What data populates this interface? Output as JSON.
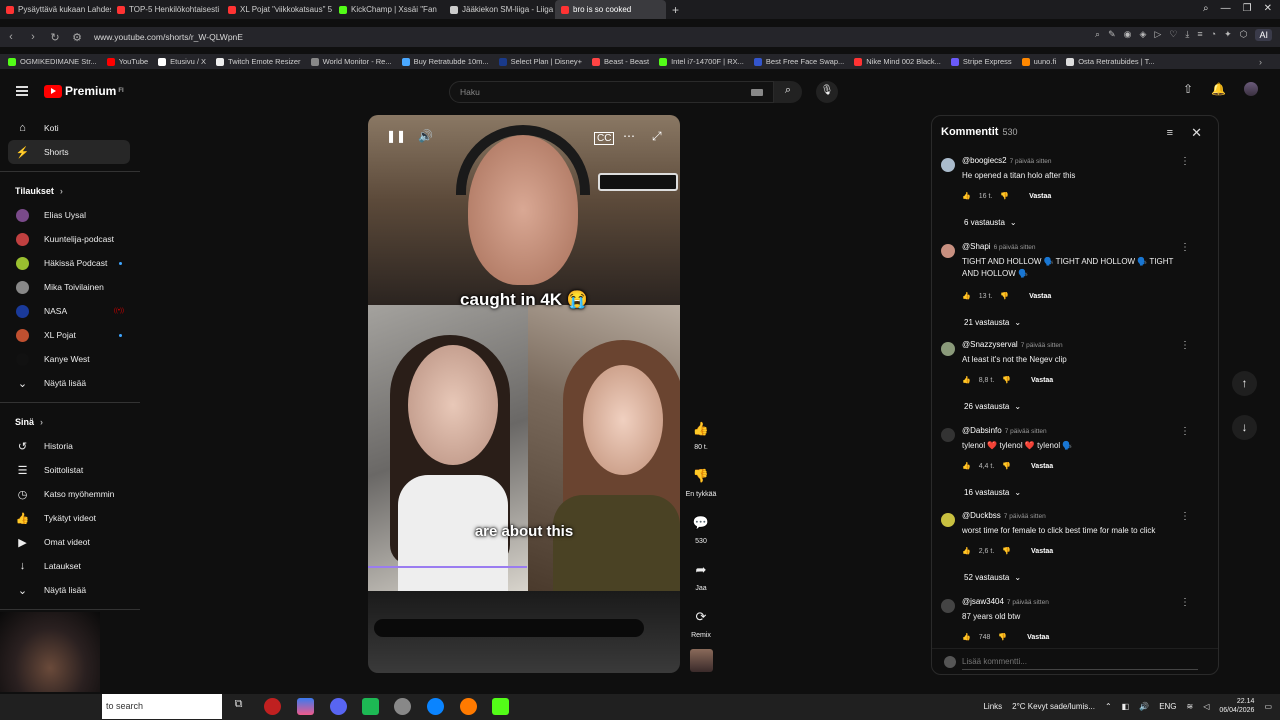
{
  "browser": {
    "tabs": [
      {
        "label": "Pysäyttävä kukaan Lahdess...",
        "color": "#ff3333"
      },
      {
        "label": "TOP-5 Henkilökohtaisesti",
        "color": "#ff3333"
      },
      {
        "label": "XL Pojat \"viikkokatsaus\" 5",
        "color": "#ff3333"
      },
      {
        "label": "KickChamp | Xssäi \"Fan",
        "color": "#53fc18"
      },
      {
        "label": "Jääkiekon SM-liiga - Liiga",
        "color": "#cccccc"
      },
      {
        "label": "bro is so cooked",
        "color": "#ff3333"
      }
    ],
    "url": "www.youtube.com/shorts/r_W-QLWpnE",
    "bookmarks": [
      {
        "label": "OGMIKEDIMANE Str...",
        "color": "#53fc18"
      },
      {
        "label": "YouTube",
        "color": "#ff0000"
      },
      {
        "label": "Etusivu / X",
        "color": "#ffffff"
      },
      {
        "label": "Twitch Emote Resizer",
        "color": "#eeeeee"
      },
      {
        "label": "World Monitor - Re...",
        "color": "#888888"
      },
      {
        "label": "Buy Retratubde 10m...",
        "color": "#4aa8ff"
      },
      {
        "label": "Select Plan | Disney+",
        "color": "#1a3a8a"
      },
      {
        "label": "Beast - Beast",
        "color": "#ff4444"
      },
      {
        "label": "Intel i7-14700F | RX...",
        "color": "#53fc18"
      },
      {
        "label": "Best Free Face Swap...",
        "color": "#3355cc"
      },
      {
        "label": "Nike Mind 002 Black...",
        "color": "#ff3333"
      },
      {
        "label": "Stripe Express",
        "color": "#6a5af9"
      },
      {
        "label": "uuno.fi",
        "color": "#ff8800"
      },
      {
        "label": "Osta Retratubides | T...",
        "color": "#dddddd"
      }
    ],
    "ai_label": "AI"
  },
  "header": {
    "logo": "Premium",
    "logo_sup": "FI",
    "search_placeholder": "Haku"
  },
  "sidebar": {
    "main": [
      {
        "label": "Koti",
        "icon": "home-icon"
      },
      {
        "label": "Shorts",
        "icon": "shorts-icon"
      }
    ],
    "subs_heading": "Tilaukset",
    "subs": [
      {
        "label": "Elias Uysal",
        "color": "#7a4a8a",
        "badge": ""
      },
      {
        "label": "Kuuntelija-podcast",
        "color": "#c04040",
        "badge": ""
      },
      {
        "label": "Häkissä Podcast",
        "color": "#9ac030",
        "badge": "dot"
      },
      {
        "label": "Mika Toivilainen",
        "color": "#888888",
        "badge": ""
      },
      {
        "label": "NASA",
        "color": "#1a3a9a",
        "badge": "live"
      },
      {
        "label": "XL Pojat",
        "color": "#c05030",
        "badge": "dot"
      },
      {
        "label": "Kanye West",
        "color": "#111111",
        "badge": ""
      }
    ],
    "show_more": "Näytä lisää",
    "you_heading": "Sinä",
    "you": [
      {
        "label": "Historia",
        "icon": "history-icon",
        "glyph": "↺"
      },
      {
        "label": "Soittolistat",
        "icon": "playlists-icon",
        "glyph": "☰"
      },
      {
        "label": "Katso myöhemmin",
        "icon": "watch-later-icon",
        "glyph": "◷"
      },
      {
        "label": "Tykätyt videot",
        "icon": "liked-icon",
        "glyph": "👍"
      },
      {
        "label": "Omat videot",
        "icon": "my-videos-icon",
        "glyph": "▶"
      },
      {
        "label": "Lataukset",
        "icon": "downloads-icon",
        "glyph": "↓"
      },
      {
        "label": "Näytä lisää",
        "icon": "chevron-down-icon",
        "glyph": "⌄"
      }
    ]
  },
  "short": {
    "caption_top": "caught in 4K 😭",
    "caption_bottom": "are about this",
    "progress": 0.51
  },
  "actions": {
    "likes": "80 t.",
    "dislike": "En tykkää",
    "comments": "530",
    "share": "Jaa",
    "remix": "Remix"
  },
  "comments": {
    "title": "Kommentit",
    "count": "530",
    "add_placeholder": "Lisää kommentti...",
    "items": [
      {
        "author": "@boogiecs2",
        "time": "7 päivää sitten",
        "text": "He opened a titan holo after this",
        "likes": "16 t.",
        "replies": "6 vastausta",
        "avatar": "#aabbcc"
      },
      {
        "author": "@Shapi",
        "time": "6 päivää sitten",
        "text": "TIGHT AND HOLLOW 🗣️ TIGHT AND HOLLOW 🗣️ TIGHT AND HOLLOW 🗣️",
        "likes": "13 t.",
        "replies": "21 vastausta",
        "avatar": "#c89080"
      },
      {
        "author": "@Snazzyserval",
        "time": "7 päivää sitten",
        "text": "At least it's not the Negev clip",
        "likes": "8,8 t.",
        "replies": "26 vastausta",
        "avatar": "#8a9a7a"
      },
      {
        "author": "@Dabsinfo",
        "time": "7 päivää sitten",
        "text": "tylenol ❤️ tylenol ❤️ tylenol 🗣️",
        "likes": "4,4 t.",
        "replies": "16 vastausta",
        "avatar": "#333333"
      },
      {
        "author": "@Duckbss",
        "time": "7 päivää sitten",
        "text": "worst time for female to click best time for male to click",
        "likes": "2,6 t.",
        "replies": "52 vastausta",
        "avatar": "#c8c040"
      },
      {
        "author": "@jsaw3404",
        "time": "7 päivää sitten",
        "text": "87 years old btw",
        "likes": "748",
        "replies": "",
        "avatar": "#444444"
      }
    ],
    "reply_label": "Vastaa"
  },
  "taskbar": {
    "search": "to search",
    "links": "Links",
    "weather": "2°C  Kevyt sade/lumis...",
    "lang": "ENG",
    "time": "22.14",
    "date": "06/04/2026"
  }
}
